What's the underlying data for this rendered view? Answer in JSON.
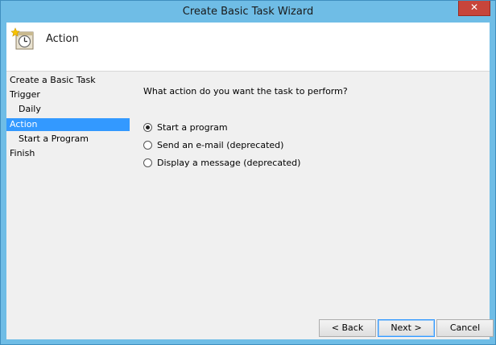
{
  "window": {
    "title": "Create Basic Task Wizard",
    "close_glyph": "✕"
  },
  "header": {
    "title": "Action",
    "icon": "task-scheduler-clock-icon"
  },
  "steps": [
    {
      "label": "Create a Basic Task",
      "level": "top",
      "active": false
    },
    {
      "label": "Trigger",
      "level": "top",
      "active": false
    },
    {
      "label": "Daily",
      "level": "sub",
      "active": false
    },
    {
      "label": "Action",
      "level": "top",
      "active": true
    },
    {
      "label": "Start a Program",
      "level": "sub",
      "active": false
    },
    {
      "label": "Finish",
      "level": "top",
      "active": false
    }
  ],
  "content": {
    "question": "What action do you want the task to perform?",
    "options": [
      {
        "label": "Start a program",
        "checked": true
      },
      {
        "label": "Send an e-mail (deprecated)",
        "checked": false
      },
      {
        "label": "Display a message (deprecated)",
        "checked": false
      }
    ]
  },
  "buttons": {
    "back": "< Back",
    "next": "Next >",
    "cancel": "Cancel"
  },
  "colors": {
    "titlebar": "#6fbde6",
    "selection": "#3399ff",
    "close": "#c7453b"
  }
}
